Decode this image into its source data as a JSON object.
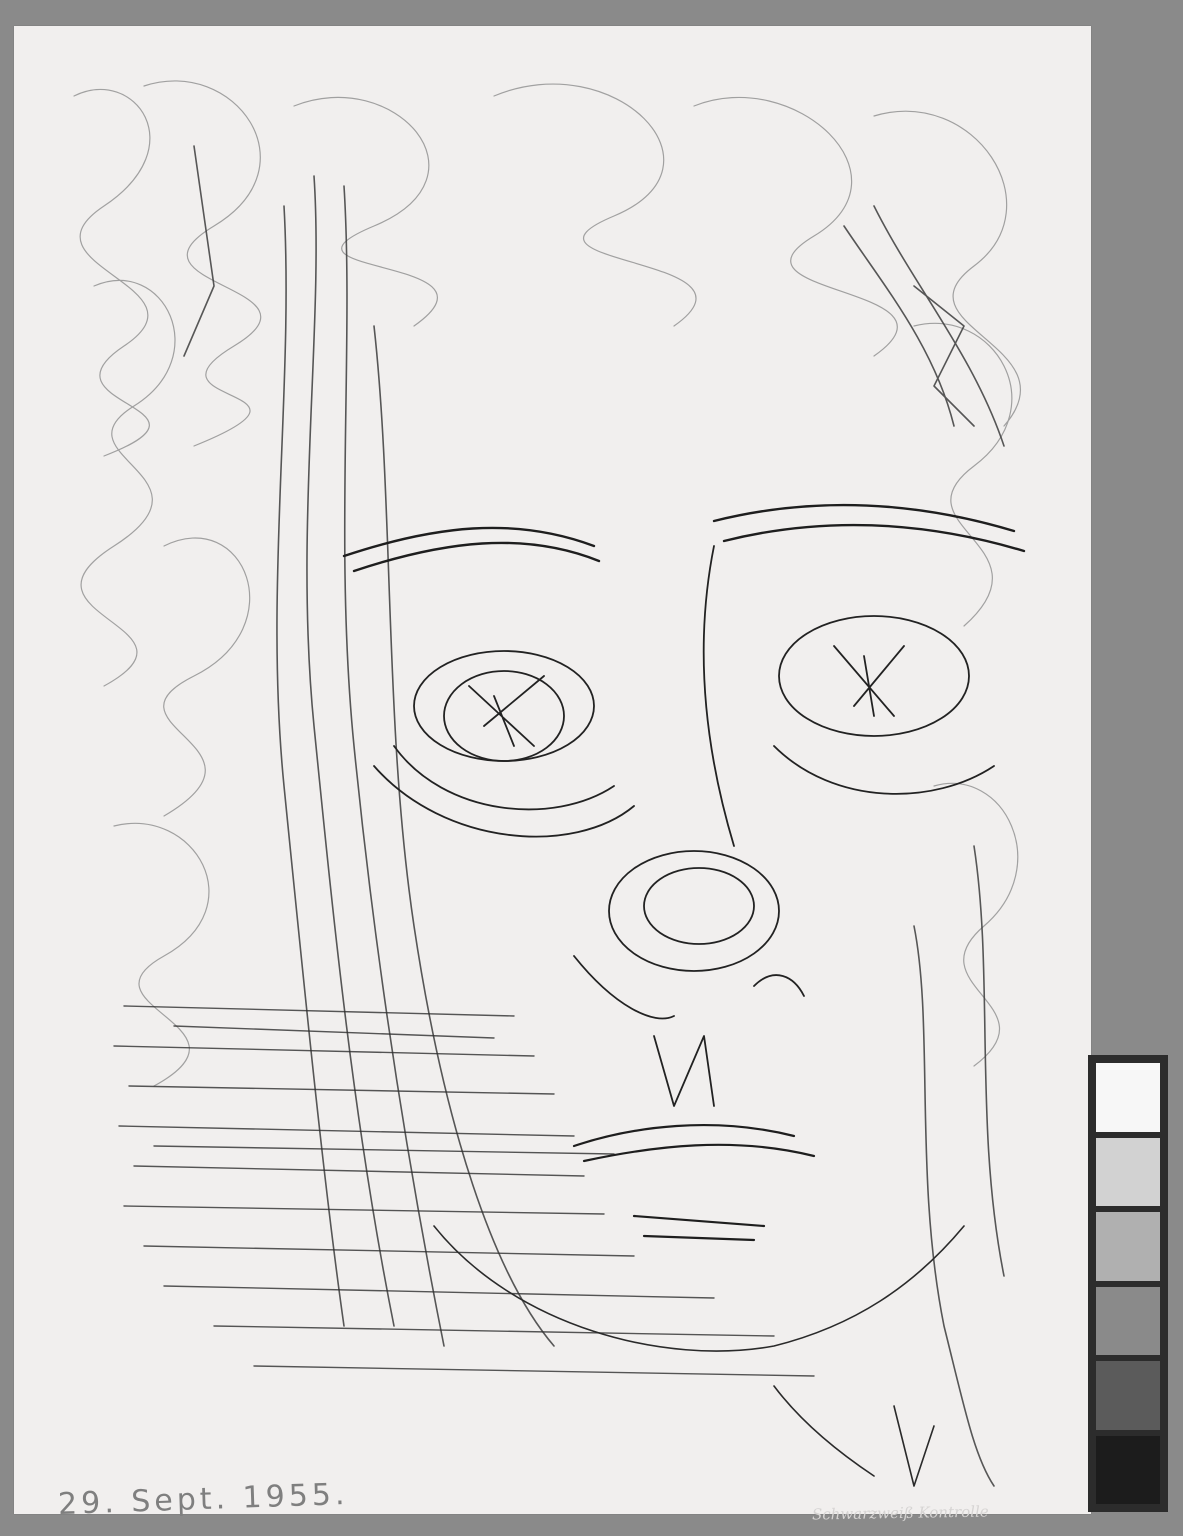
{
  "artwork": {
    "inscription": "29. Sept. 1955.",
    "faint_note": "Schwarzweiß Kontrolle"
  },
  "gray_scale": {
    "patches": [
      "#f7f7f7",
      "#d2d2d2",
      "#b0b0b0",
      "#8a8a8a",
      "#5b5b5b",
      "#1c1c1c"
    ]
  }
}
